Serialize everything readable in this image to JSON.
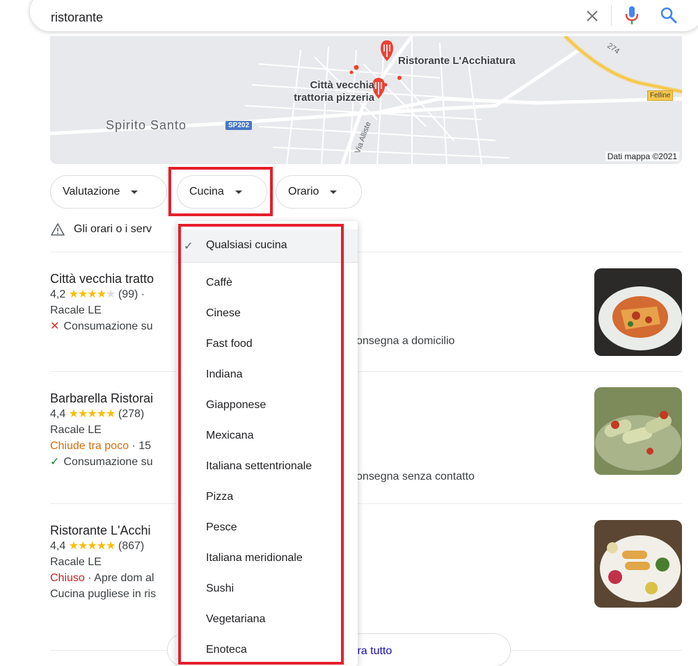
{
  "search": {
    "query": "ristorante"
  },
  "map": {
    "pins": [
      "Ristorante L'Acchiatura",
      "Città vecchia trattoria pizzeria"
    ],
    "places": [
      "Spirito Santo"
    ],
    "road_badges": [
      "SP202"
    ],
    "town_badges": [
      "Felline"
    ],
    "road_labels": [
      "Via Alliste",
      "274"
    ],
    "attribution": "Dati mappa ©2021"
  },
  "filters": {
    "chips": [
      "Valutazione",
      "Cucina",
      "Orario"
    ]
  },
  "notice": {
    "text": "Gli orari o i serv"
  },
  "cuisine_menu": {
    "selected": "Qualsiasi cucina",
    "items": [
      "Caffè",
      "Cinese",
      "Fast food",
      "Indiana",
      "Giapponese",
      "Mexicana",
      "Italiana settentrionale",
      "Pizza",
      "Pesce",
      "Italiana meridionale",
      "Sushi",
      "Vegetariana",
      "Enoteca"
    ]
  },
  "results": [
    {
      "title": "Città vecchia tratto",
      "rating": "4,2",
      "stars": 4.2,
      "reviews": "(99) ·",
      "location": "Racale LE",
      "service_left": "Consumazione su",
      "service_right": "onsegna a domicilio"
    },
    {
      "title": "Barbarella Ristorai",
      "rating": "4,4",
      "stars": 4.4,
      "reviews": "(278)",
      "location": "Racale LE",
      "status": "Chiude tra poco",
      "status_rest": " · 15",
      "service_left": "Consumazione su",
      "service_right": "onsegna senza contatto"
    },
    {
      "title": "Ristorante L'Acchi",
      "rating": "4,4",
      "stars": 4.4,
      "reviews": "(867)",
      "location": "Racale LE",
      "status": "Chiuso",
      "status_rest": " · Apre dom al",
      "description": "Cucina pugliese in ris"
    }
  ],
  "show_all": {
    "label": "tra tutto"
  },
  "colors": {
    "highlight": "#e3202b",
    "star": "#fbbc04",
    "link": "#1a0dab",
    "closed": "#c5221f",
    "closing": "#d56e0c",
    "check": "#188038"
  }
}
